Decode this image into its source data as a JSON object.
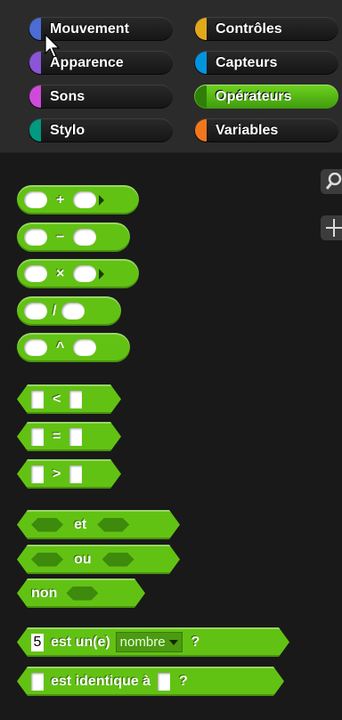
{
  "categories": [
    {
      "label": "Mouvement",
      "color": "#4a6cd4"
    },
    {
      "label": "Contrôles",
      "color": "#e1a91a"
    },
    {
      "label": "Apparence",
      "color": "#8a55d7"
    },
    {
      "label": "Capteurs",
      "color": "#0094dd"
    },
    {
      "label": "Sons",
      "color": "#cf4ad9"
    },
    {
      "label": "Opérateurs",
      "color": "#62c213"
    },
    {
      "label": "Stylo",
      "color": "#009982"
    },
    {
      "label": "Variables",
      "color": "#f3761d"
    }
  ],
  "active_category": "Opérateurs",
  "palette": {
    "tool_search_icon": "magnifier-icon",
    "tool_add_icon": "plus-icon",
    "ops": {
      "plus": "+",
      "minus": "−",
      "times": "×",
      "divide": "/",
      "power": "^"
    },
    "comparisons": {
      "lt": "<",
      "eq": "=",
      "gt": ">"
    },
    "logic": {
      "and": "et",
      "or": "ou",
      "not": "non"
    },
    "is_a": {
      "value": "5",
      "label": "est un(e)",
      "type": "nombre",
      "q": "?"
    },
    "identical": {
      "label": "est identique à",
      "q": "?"
    }
  },
  "colors": {
    "operators": "#62c213",
    "background": "#191919",
    "category_bar": "#2b2b2b"
  }
}
